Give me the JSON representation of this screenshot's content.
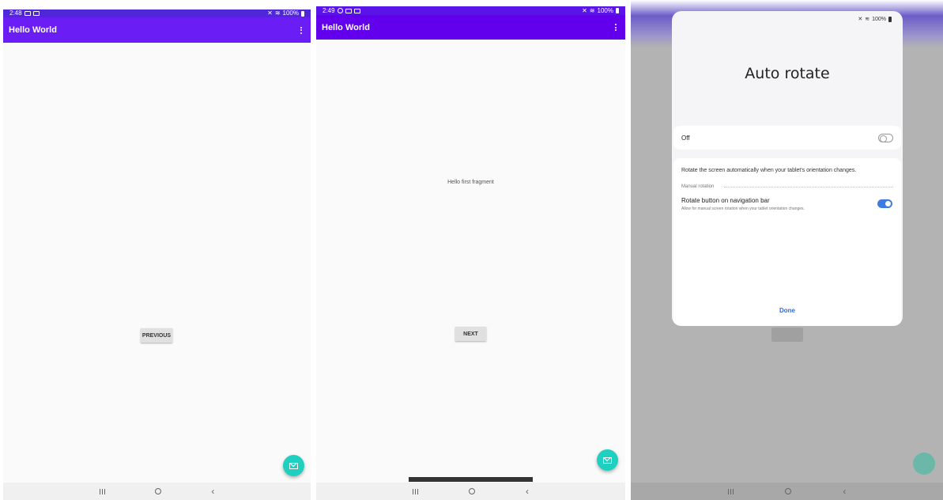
{
  "panel1": {
    "status": {
      "time": "2:48",
      "battery": "100%"
    },
    "appbar": {
      "title": "Hello World"
    },
    "button_label": "PREVIOUS"
  },
  "panel2": {
    "status": {
      "time": "2:49",
      "battery": "100%"
    },
    "appbar": {
      "title": "Hello World"
    },
    "fragment_text": "Hello first fragment",
    "button_label": "NEXT"
  },
  "panel3": {
    "status": {
      "battery": "100%"
    },
    "dialog": {
      "title": "Auto rotate",
      "off_label": "Off",
      "info_text": "Rotate the screen automatically when your tablet's orientation changes.",
      "section_label": "Manual rotation",
      "setting_title": "Rotate button on navigation bar",
      "setting_desc": "Allow for manual screen rotation when your tablet orientation changes.",
      "done_label": "Done"
    }
  },
  "icons": {
    "overflow": "more-vert-icon",
    "fab": "mail-icon",
    "nav_recents": "recents-icon",
    "nav_home": "home-icon",
    "nav_back": "back-icon"
  },
  "colors": {
    "appbar": "#6200ee",
    "fab": "#1fd0c1",
    "toggle_on": "#3e7be3"
  }
}
